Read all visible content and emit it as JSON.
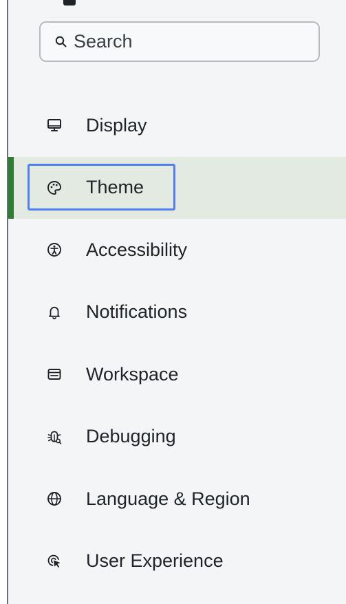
{
  "search": {
    "placeholder": "Search"
  },
  "colors": {
    "background": "#f4f5f7",
    "active_background": "#e3eae2",
    "active_indicator": "#2e7d32",
    "focus_ring": "#4f7df5",
    "text": "#1f2328"
  },
  "sidebar": {
    "selected": "Theme",
    "items": [
      {
        "label": "Display",
        "icon": "monitor-icon"
      },
      {
        "label": "Theme",
        "icon": "palette-icon"
      },
      {
        "label": "Accessibility",
        "icon": "accessibility-icon"
      },
      {
        "label": "Notifications",
        "icon": "bell-icon"
      },
      {
        "label": "Workspace",
        "icon": "window-icon"
      },
      {
        "label": "Debugging",
        "icon": "bug-icon"
      },
      {
        "label": "Language & Region",
        "icon": "globe-icon"
      },
      {
        "label": "User Experience",
        "icon": "cursor-click-icon"
      }
    ]
  }
}
